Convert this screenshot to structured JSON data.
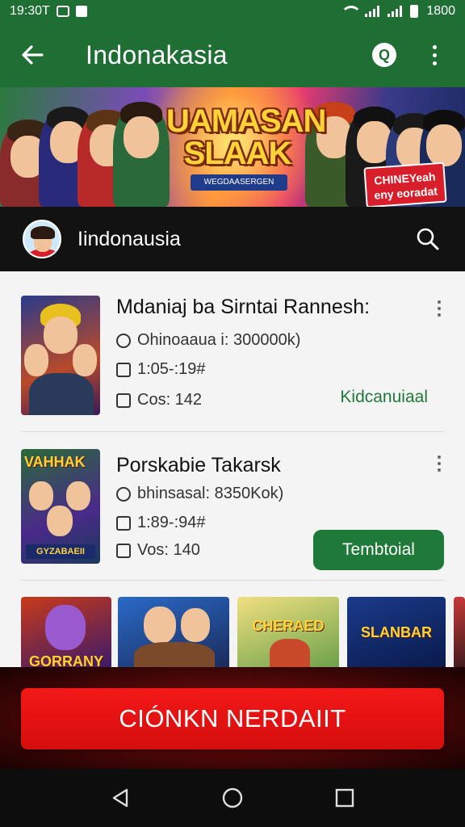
{
  "status_bar": {
    "time": "19:30T",
    "battery_text": "1800"
  },
  "app_bar": {
    "title": "Indonakasia"
  },
  "banner": {
    "title_line1": "UAMASAN",
    "title_line2": "SLAAK",
    "subtitle": "WEGDAASERGEN",
    "badge": "CHINEYeah eny eoradat"
  },
  "profile": {
    "name": "Iindonausia"
  },
  "items": [
    {
      "title": "Mdaniaj ba Sirntai Rannesh:",
      "meta1": "Ohinoaaua i: 300000k)",
      "meta2": "1:05-:19#",
      "meta3": "Cos: 142",
      "action": "Kidcanuiaal"
    },
    {
      "title": "Porskabie Takarsk",
      "meta1": "bhinsasal: 8350Kok)",
      "meta2": "1:89-:94#",
      "meta3": "Vos: 140",
      "action": "Tembtoial"
    }
  ],
  "thumb_row": {
    "labels": [
      "GORRANY",
      "",
      "CHERAED",
      "SLANBAR",
      ""
    ]
  },
  "cta": {
    "label": "CIÓNKN NERDAIIT"
  },
  "colors": {
    "primary": "#1f6e34",
    "accent_green": "#1f7a3a",
    "cta_red": "#e01010"
  }
}
